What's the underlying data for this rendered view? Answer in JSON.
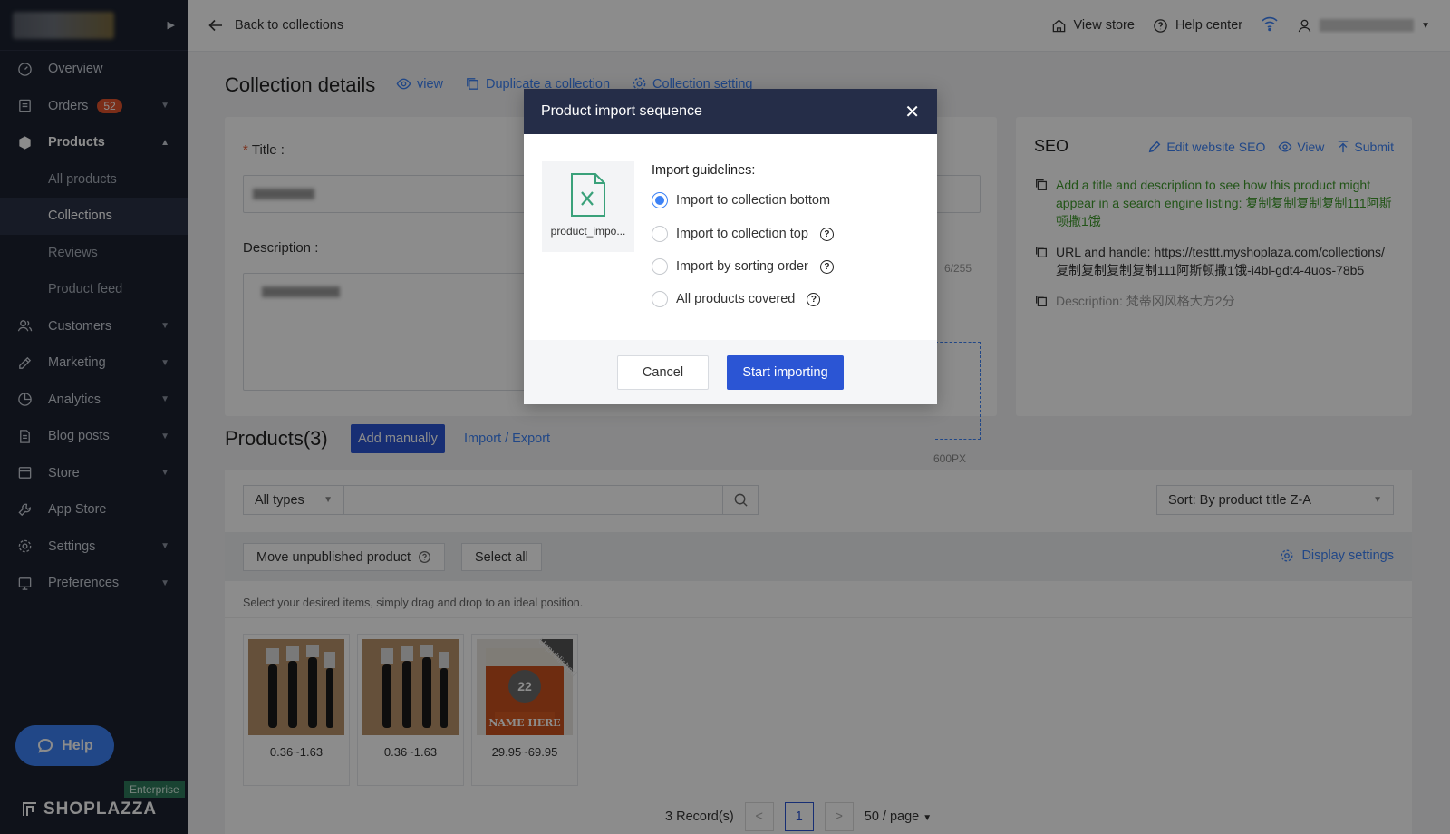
{
  "sidebar": {
    "items": [
      {
        "label": "Overview",
        "icon": "gauge-icon"
      },
      {
        "label": "Orders",
        "badge": "52",
        "icon": "orders-icon"
      },
      {
        "label": "Products",
        "icon": "box-icon"
      },
      {
        "label": "Customers",
        "icon": "users-icon"
      },
      {
        "label": "Marketing",
        "icon": "megaphone-icon"
      },
      {
        "label": "Analytics",
        "icon": "pie-icon"
      },
      {
        "label": "Blog posts",
        "icon": "document-icon"
      },
      {
        "label": "Store",
        "icon": "store-icon"
      },
      {
        "label": "App Store",
        "icon": "wrench-icon"
      },
      {
        "label": "Settings",
        "icon": "gear-icon"
      },
      {
        "label": "Preferences",
        "icon": "preferences-icon"
      }
    ],
    "products_sub": [
      "All products",
      "Collections",
      "Reviews",
      "Product feed"
    ],
    "help_label": "Help",
    "enterprise_label": "Enterprise",
    "brand": "SHOPLAZZA"
  },
  "topbar": {
    "back_label": "Back to collections",
    "view_store": "View store",
    "help_center": "Help center"
  },
  "page": {
    "title": "Collection details",
    "links": [
      "view",
      "Duplicate a collection",
      "Collection setting"
    ],
    "title_label": "Title",
    "description_label": "Description",
    "counter": "6/255",
    "image_hint": "600PX"
  },
  "seo": {
    "title": "SEO",
    "edit": "Edit website SEO",
    "view": "View",
    "submit": "Submit",
    "hint": "Add a title and description to see how this product might appear in a search engine listing: 复制复制复制复制111阿斯顿撒1饿",
    "url_label": "URL and handle: https://testtt.myshoplaza.com/collections/复制复制复制复制111阿斯顿撒1饿-i4bl-gdt4-4uos-78b5",
    "description": "Description: 梵蒂冈风格大方2分"
  },
  "products": {
    "title": "Products(3)",
    "add_manually": "Add manually",
    "import_export": "Import / Export",
    "filter_type": "All types",
    "sort": "Sort: By product title Z-A",
    "move_unpublished": "Move unpublished product",
    "select_all": "Select all",
    "display_settings": "Display settings",
    "hint": "Select your desired items, simply drag and drop to an ideal position.",
    "items": [
      {
        "price": "0.36~1.63"
      },
      {
        "price": "0.36~1.63"
      },
      {
        "price": "29.95~69.95",
        "ribbon": "Unpublished",
        "overlay": "NAME HERE",
        "number": "22"
      }
    ],
    "records": "3 Record(s)",
    "page": "1",
    "per_page": "50 / page"
  },
  "modal": {
    "title": "Product import sequence",
    "file_name": "product_impo...",
    "guidelines_title": "Import guidelines:",
    "options": [
      "Import to collection bottom",
      "Import to collection top",
      "Import by sorting order",
      "All products covered"
    ],
    "cancel": "Cancel",
    "start": "Start importing"
  },
  "colors": {
    "accent": "#3c82f6",
    "primary_button": "#2b55d4",
    "sidebar_bg": "#1c2230",
    "modal_header": "#252d48"
  }
}
